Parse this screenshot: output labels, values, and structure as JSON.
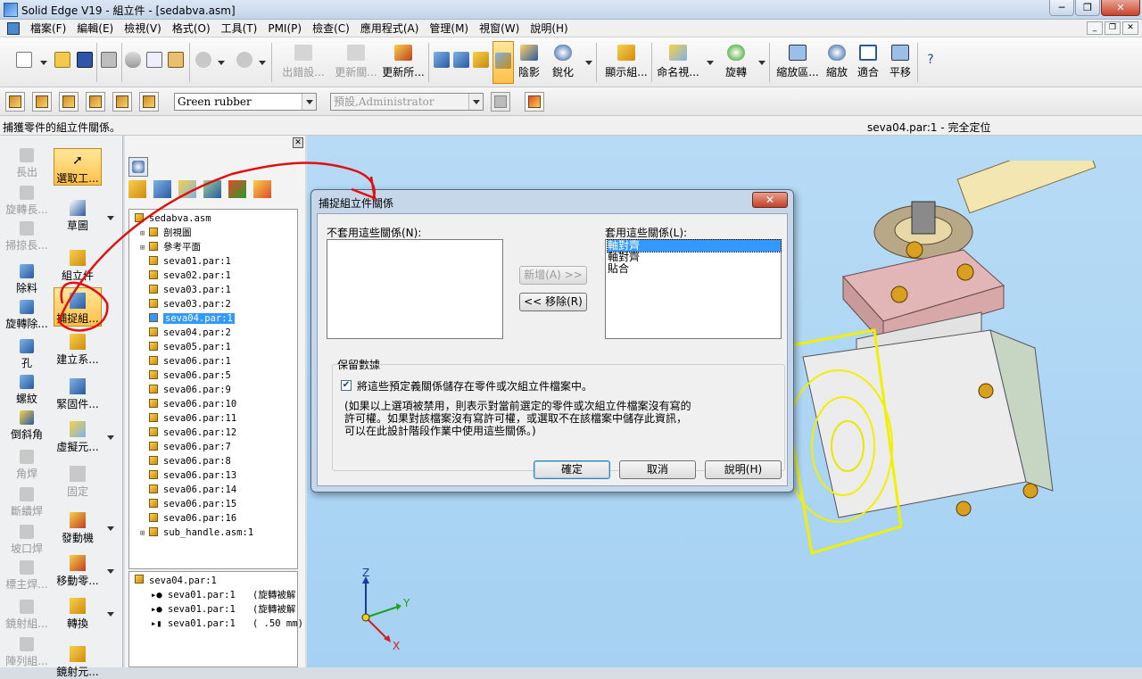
{
  "window": {
    "title": "Solid Edge V19 - 組立件 - [sedabva.asm]"
  },
  "menu": [
    "檔案(F)",
    "編輯(E)",
    "檢視(V)",
    "格式(O)",
    "工具(T)",
    "PMI(P)",
    "檢查(C)",
    "應用程式(A)",
    "管理(M)",
    "視窗(W)",
    "說明(H)"
  ],
  "toolbar": {
    "out_breakdown": "出錯設...",
    "update_link": "更新關...",
    "update_all": "更新所...",
    "shading": "陰影",
    "sharpen": "銳化",
    "show_assembly": "顯示組...",
    "name_view": "命名視...",
    "rotate": "旋轉",
    "zoom_area": "縮放區...",
    "zoom": "縮放",
    "fit": "適合",
    "pan": "平移"
  },
  "toolbar2": {
    "material": "Green rubber",
    "preset": "預設,Administrator"
  },
  "status": {
    "left": "捕獲零件的組立件關係。",
    "right": "seva04.par:1 - 完全定位"
  },
  "leftbar": {
    "col1": [
      "長出",
      "旋轉長...",
      "掃掠長...",
      "除料",
      "旋轉除...",
      "孔",
      "螺紋",
      "倒斜角",
      "角焊",
      "斷續焊",
      "坡口焊",
      "標主焊...",
      "鏡射組...",
      "陣列組..."
    ],
    "col2": [
      "選取工...",
      "草圖",
      "組立件",
      "捕捉組...",
      "建立系...",
      "緊固件...",
      "虛擬元...",
      "固定",
      "發動機",
      "移動零...",
      "轉換",
      "鏡射元..."
    ]
  },
  "tree": {
    "root": "sedabva.asm",
    "items": [
      {
        "label": "剖視圖",
        "type": "view"
      },
      {
        "label": "參考平面",
        "type": "plane"
      },
      {
        "label": "seva01.par:1"
      },
      {
        "label": "seva02.par:1"
      },
      {
        "label": "seva03.par:1"
      },
      {
        "label": "seva03.par:2"
      },
      {
        "label": "seva04.par:1",
        "selected": true
      },
      {
        "label": "seva04.par:2"
      },
      {
        "label": "seva05.par:1"
      },
      {
        "label": "seva06.par:1"
      },
      {
        "label": "seva06.par:5"
      },
      {
        "label": "seva06.par:9"
      },
      {
        "label": "seva06.par:10"
      },
      {
        "label": "seva06.par:11"
      },
      {
        "label": "seva06.par:12"
      },
      {
        "label": "seva06.par:7"
      },
      {
        "label": "seva06.par:8"
      },
      {
        "label": "seva06.par:13"
      },
      {
        "label": "seva06.par:14"
      },
      {
        "label": "seva06.par:15"
      },
      {
        "label": "seva06.par:16"
      },
      {
        "label": "sub_handle.asm:1"
      }
    ]
  },
  "relations": {
    "part": "seva04.par:1",
    "rows": [
      {
        "part": "seva01.par:1",
        "info": "(旋轉被解"
      },
      {
        "part": "seva01.par:1",
        "info": "(旋轉被解"
      },
      {
        "part": "seva01.par:1",
        "info": "( .50 mm)"
      }
    ]
  },
  "dialog": {
    "title": "捕捉組立件關係",
    "unused_label": "不套用這些關係(N):",
    "used_label": "套用這些關係(L):",
    "used_items": [
      "軸對齊",
      "軸對齊",
      "貼合"
    ],
    "add_button": "新增(A) >>",
    "remove_button": "<< 移除(R)",
    "group_label": "保留數據",
    "checkbox_label": "將這些預定義關係儲存在零件或次組立件檔案中。",
    "note": "(如果以上選項被禁用，則表示對當前選定的零件或次組立件檔案沒有寫的\n許可權。如果對該檔案沒有寫許可權，或選取不在該檔案中儲存此資訊，\n可以在此設計階段作業中使用這些關係。)",
    "ok": "確定",
    "cancel": "取消",
    "help": "說明(H)"
  },
  "axes": {
    "x": "X",
    "y": "Y",
    "z": "Z"
  }
}
